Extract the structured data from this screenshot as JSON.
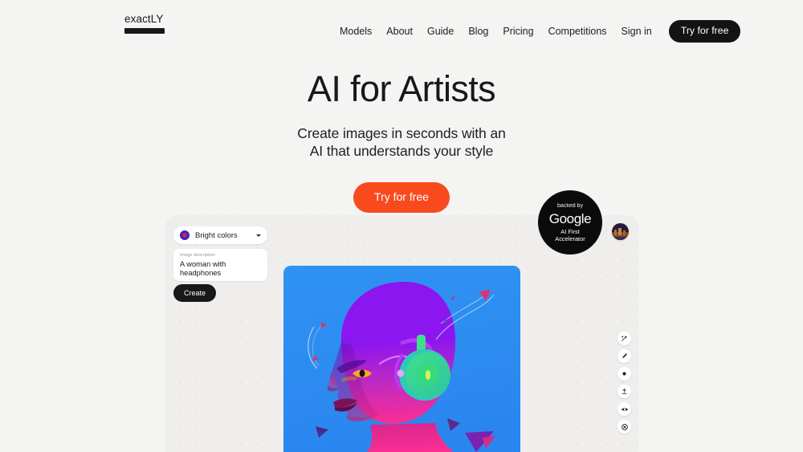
{
  "brand": {
    "name": "exactLY"
  },
  "nav": {
    "links": [
      {
        "label": "Models"
      },
      {
        "label": "About"
      },
      {
        "label": "Guide"
      },
      {
        "label": "Blog"
      },
      {
        "label": "Pricing"
      },
      {
        "label": "Competitions"
      },
      {
        "label": "Sign in"
      }
    ],
    "cta_label": "Try for free"
  },
  "hero": {
    "title": "AI for Artists",
    "subtitle_line1": "Create images in seconds with an",
    "subtitle_line2": "AI that understands your style",
    "cta_label": "Try for free"
  },
  "badge": {
    "top": "backed by",
    "brand": "Google",
    "line1": "AI First",
    "line2": "Accelerator"
  },
  "app": {
    "style_selector": {
      "value": "Bright colors",
      "swatch_colors": [
        "#e8192c",
        "#3a22c8"
      ],
      "caret_icon": "chevron-down-icon"
    },
    "description_field": {
      "label": "Image description",
      "value": "A woman with headphones"
    },
    "create_label": "Create",
    "tools": [
      {
        "icon": "magic-wand-icon"
      },
      {
        "icon": "brush-icon"
      },
      {
        "icon": "dot-brush-icon"
      },
      {
        "icon": "upload-icon"
      },
      {
        "icon": "eye-icon"
      },
      {
        "icon": "close-circle-icon"
      }
    ],
    "artwork": {
      "alt": "woman-with-headphones-illustration",
      "background": "#2a8ff0",
      "skin_top": "#8a18e8",
      "skin_bottom": "#f42a9a",
      "headphone_color": "#36d67e"
    }
  },
  "theme": {
    "page_bg": "#f4f4f3",
    "accent": "#f94a1e",
    "ink": "#16181a",
    "panel_bg": "#efeeec"
  }
}
